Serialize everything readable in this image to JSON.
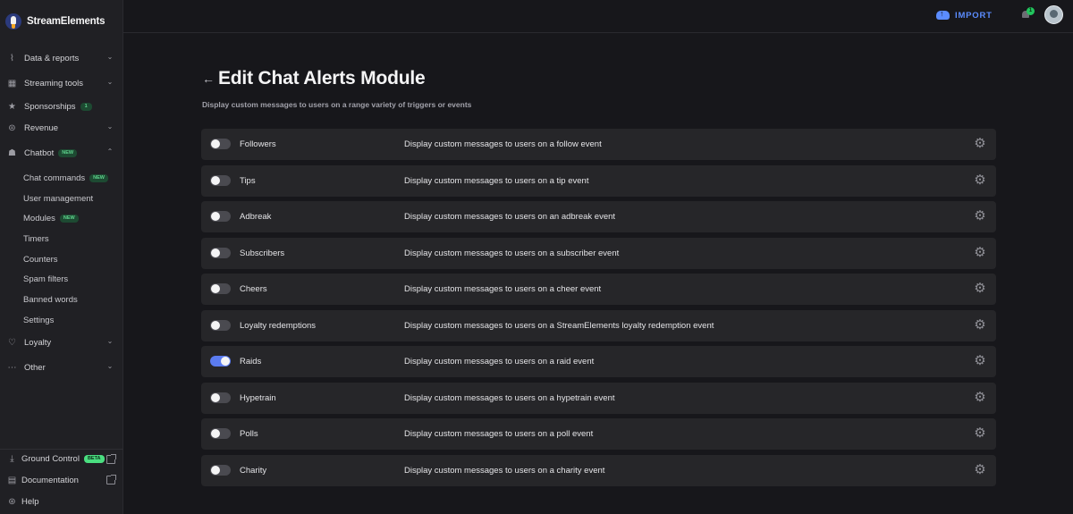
{
  "brand": {
    "name": "StreamElements"
  },
  "sidebar": {
    "items": [
      {
        "label": "Data & reports",
        "icon": "chart-line-icon",
        "has_chevron": true
      },
      {
        "label": "Streaming tools",
        "icon": "layout-icon",
        "has_chevron": true
      },
      {
        "label": "Sponsorships",
        "icon": "star-icon",
        "badge": "1"
      },
      {
        "label": "Revenue",
        "icon": "dollar-circle-icon",
        "has_chevron": true
      },
      {
        "label": "Chatbot",
        "icon": "robot-icon",
        "badge": "NEW",
        "expanded": true
      }
    ],
    "chatbot_sub": [
      {
        "label": "Chat commands",
        "badge": "NEW"
      },
      {
        "label": "User management"
      },
      {
        "label": "Modules",
        "badge": "NEW"
      },
      {
        "label": "Timers"
      },
      {
        "label": "Counters"
      },
      {
        "label": "Spam filters"
      },
      {
        "label": "Banned words"
      },
      {
        "label": "Settings"
      }
    ],
    "lower_items": [
      {
        "label": "Loyalty",
        "icon": "hand-heart-icon"
      },
      {
        "label": "Other",
        "icon": "more-icon"
      }
    ],
    "footer": [
      {
        "label": "Ground Control",
        "badge": "BETA",
        "icon": "download-icon",
        "external": true
      },
      {
        "label": "Documentation",
        "icon": "document-icon",
        "external": true
      },
      {
        "label": "Help",
        "icon": "help-lifebuoy-icon"
      }
    ]
  },
  "topbar": {
    "import_label": "IMPORT",
    "notification_count": "1"
  },
  "page": {
    "title": "Edit Chat Alerts Module",
    "subtitle": "Display custom messages to users on a range variety of triggers or events"
  },
  "alerts": [
    {
      "name": "Followers",
      "description": "Display custom messages to users on a follow event",
      "enabled": false
    },
    {
      "name": "Tips",
      "description": "Display custom messages to users on a tip event",
      "enabled": false
    },
    {
      "name": "Adbreak",
      "description": "Display custom messages to users on an adbreak event",
      "enabled": false
    },
    {
      "name": "Subscribers",
      "description": "Display custom messages to users on a subscriber event",
      "enabled": false
    },
    {
      "name": "Cheers",
      "description": "Display custom messages to users on a cheer event",
      "enabled": false
    },
    {
      "name": "Loyalty redemptions",
      "description": "Display custom messages to users on a StreamElements loyalty redemption event",
      "enabled": false
    },
    {
      "name": "Raids",
      "description": "Display custom messages to users on a raid event",
      "enabled": true
    },
    {
      "name": "Hypetrain",
      "description": "Display custom messages to users on a hypetrain event",
      "enabled": false
    },
    {
      "name": "Polls",
      "description": "Display custom messages to users on a poll event",
      "enabled": false
    },
    {
      "name": "Charity",
      "description": "Display custom messages to users on a charity event",
      "enabled": false
    }
  ],
  "colors": {
    "accent": "#5b8cff",
    "toggle_on": "#5b7cf0",
    "badge_green": "#4ade80"
  }
}
